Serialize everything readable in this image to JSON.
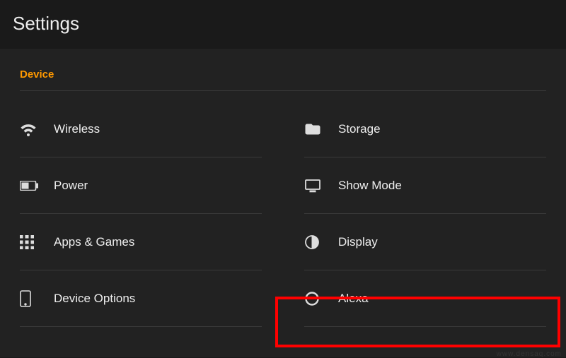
{
  "header": {
    "title": "Settings"
  },
  "section": {
    "label": "Device"
  },
  "items": {
    "wireless": {
      "label": "Wireless"
    },
    "storage": {
      "label": "Storage"
    },
    "power": {
      "label": "Power"
    },
    "show_mode": {
      "label": "Show Mode"
    },
    "apps_games": {
      "label": "Apps & Games"
    },
    "display": {
      "label": "Display"
    },
    "device_options": {
      "label": "Device Options"
    },
    "alexa": {
      "label": "Alexa"
    }
  },
  "highlight_target": "alexa",
  "watermark": "www.densaq.com"
}
